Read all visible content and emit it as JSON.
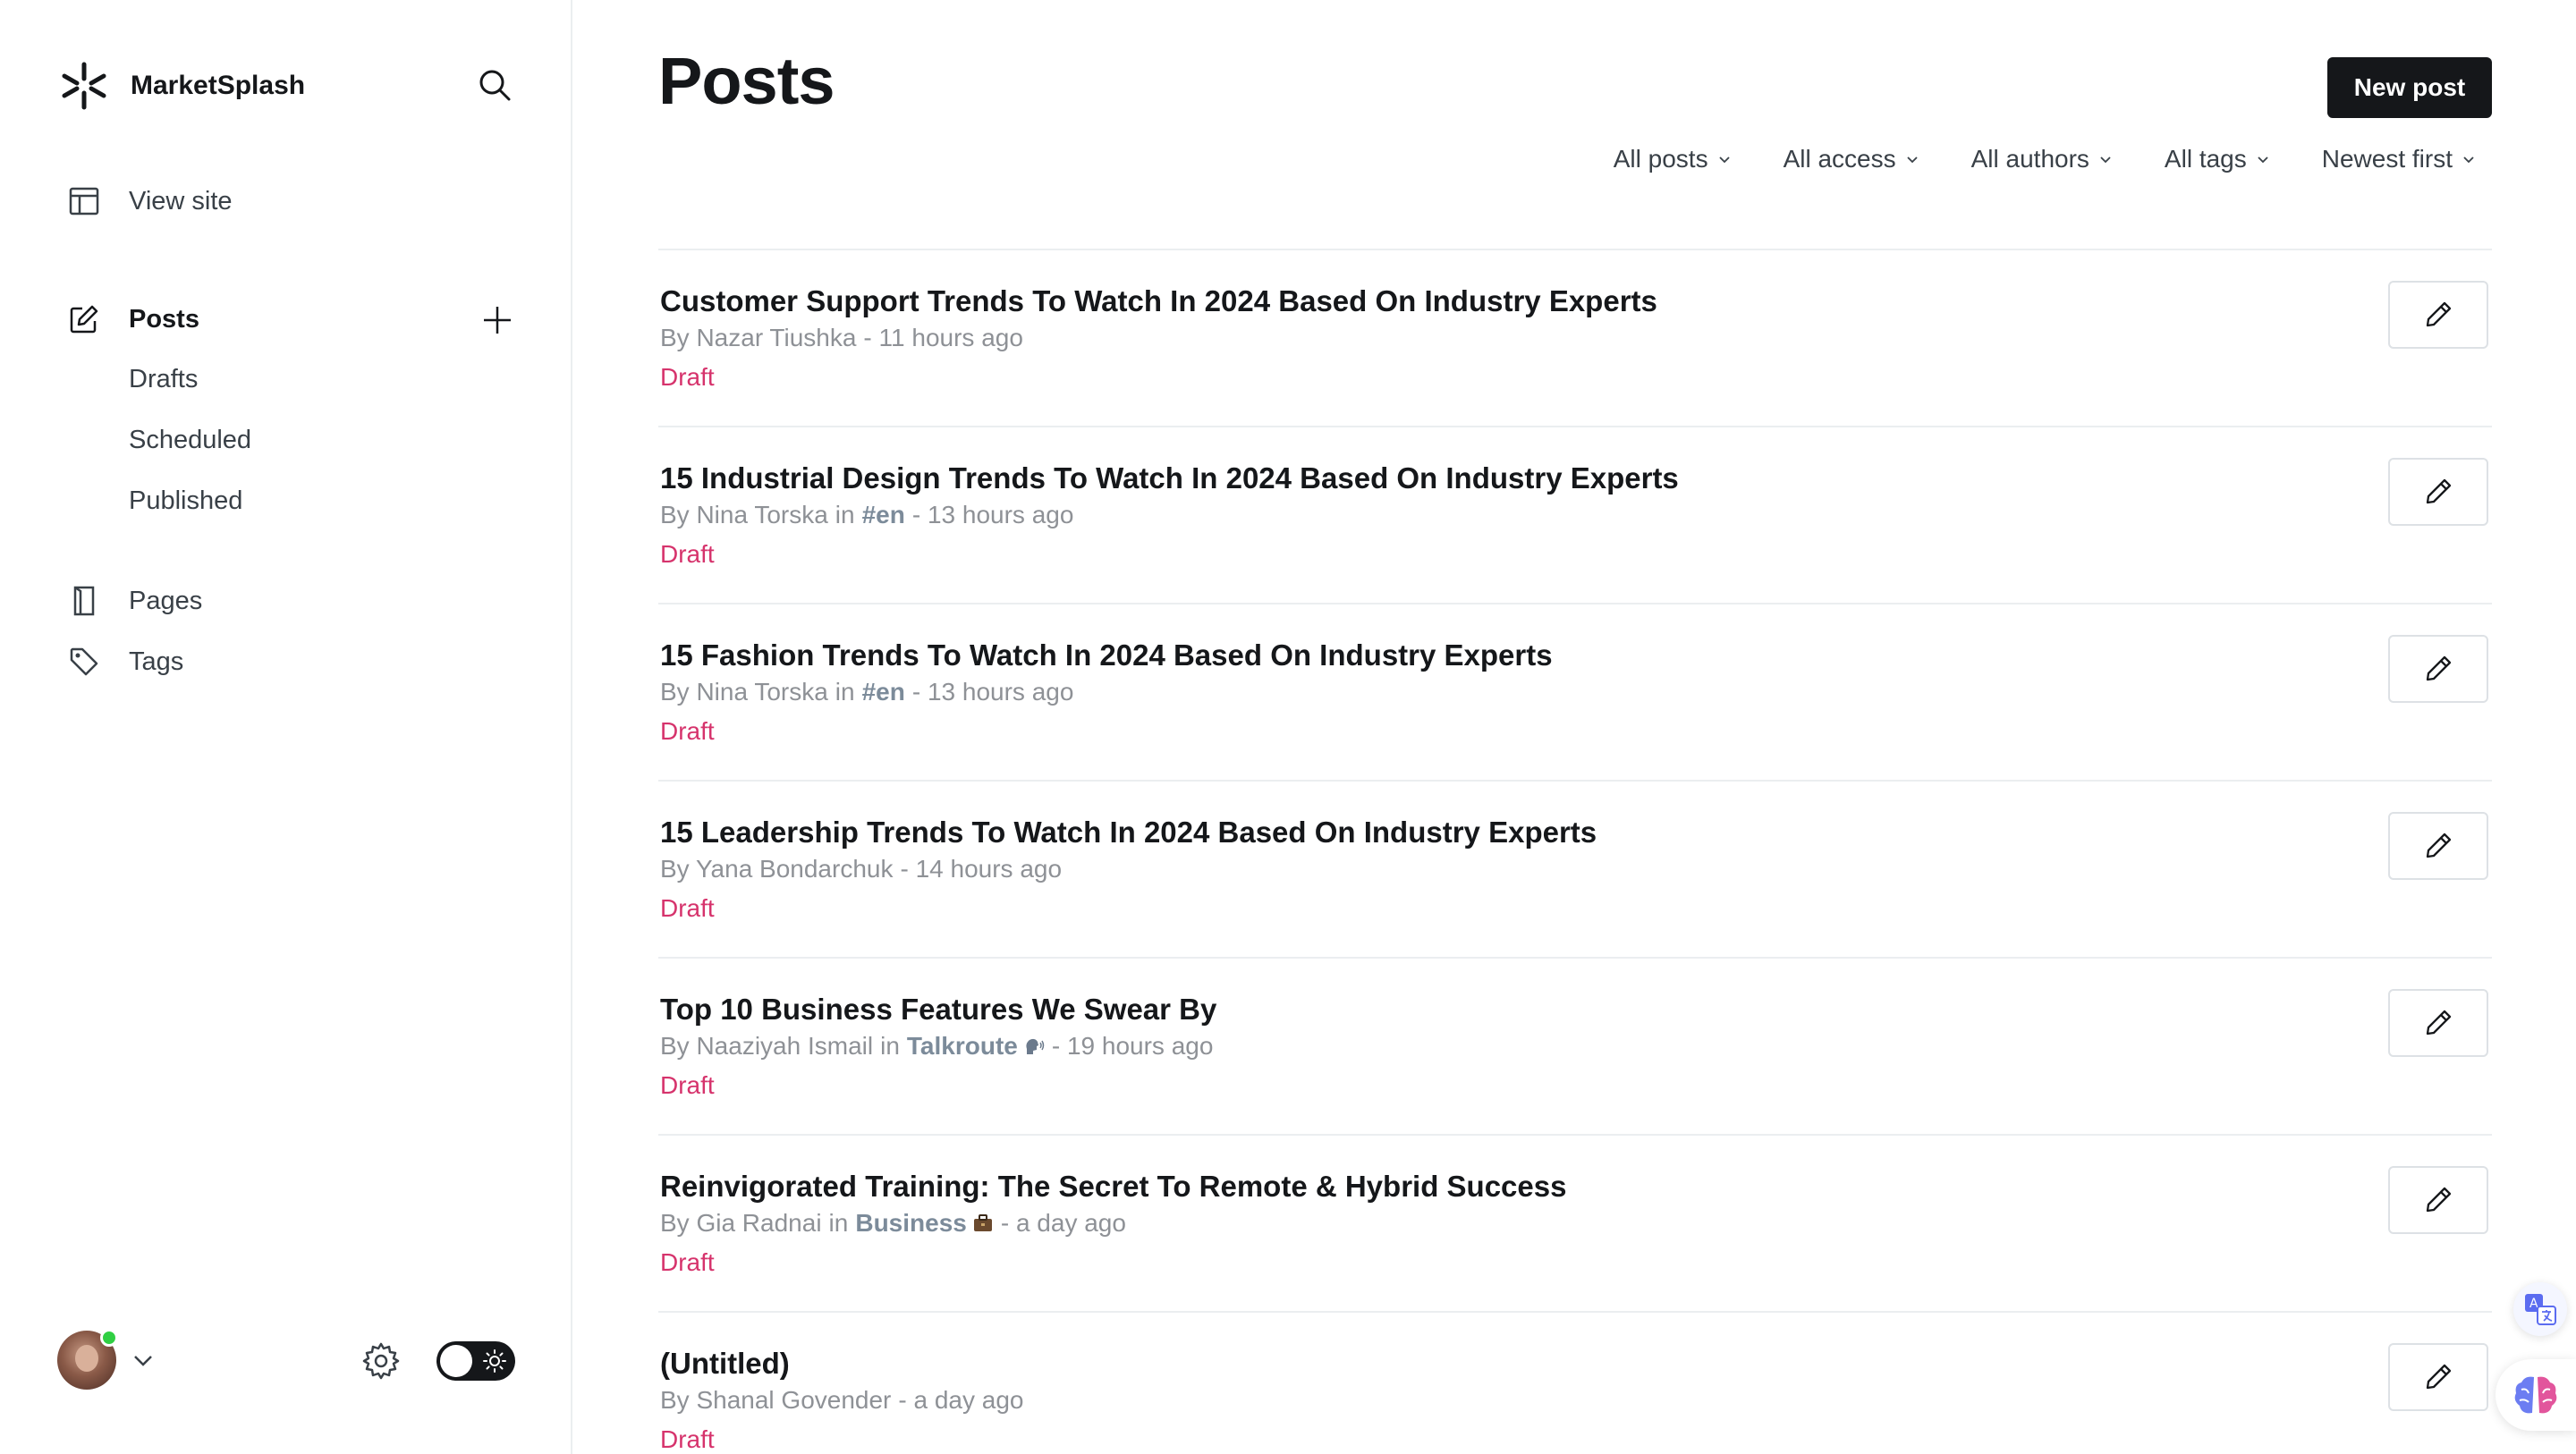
{
  "brand": {
    "name": "MarketSplash"
  },
  "sidebar": {
    "view_site": "View site",
    "posts": "Posts",
    "sub_items": [
      "Drafts",
      "Scheduled",
      "Published"
    ],
    "pages": "Pages",
    "tags": "Tags"
  },
  "header": {
    "title": "Posts",
    "new_post_label": "New post"
  },
  "filters": [
    "All posts",
    "All access",
    "All authors",
    "All tags",
    "Newest first"
  ],
  "posts": [
    {
      "title": "Customer Support Trends To Watch In 2024 Based On Industry Experts",
      "by": "By Nazar Tiushka",
      "in": "",
      "tag": "",
      "time": "- 11 hours ago",
      "status": "Draft"
    },
    {
      "title": "15 Industrial Design Trends To Watch In 2024 Based On Industry Experts",
      "by": "By Nina Torska",
      "in": "in",
      "tag": "#en",
      "time": "- 13 hours ago",
      "status": "Draft"
    },
    {
      "title": "15 Fashion Trends To Watch In 2024 Based On Industry Experts",
      "by": "By Nina Torska",
      "in": "in",
      "tag": "#en",
      "time": "- 13 hours ago",
      "status": "Draft"
    },
    {
      "title": "15 Leadership Trends To Watch In 2024 Based On Industry Experts",
      "by": "By Yana Bondarchuk",
      "in": "",
      "tag": "",
      "time": "- 14 hours ago",
      "status": "Draft"
    },
    {
      "title": "Top 10 Business Features We Swear By",
      "by": "By Naaziyah Ismail",
      "in": "in",
      "tag": "Talkroute",
      "time": "- 19 hours ago",
      "status": "Draft",
      "tag_icon": "speaking-head-emoji"
    },
    {
      "title": "Reinvigorated Training: The Secret To Remote & Hybrid Success",
      "by": "By Gia Radnai",
      "in": "in",
      "tag": "Business",
      "time": "- a day ago",
      "status": "Draft",
      "tag_icon": "briefcase-emoji"
    },
    {
      "title": "(Untitled)",
      "by": "By Shanal Govender",
      "in": "",
      "tag": "",
      "time": "- a day ago",
      "status": "Draft"
    }
  ],
  "colors": {
    "accent_draft": "#d6336c",
    "primary_dark": "#15171a",
    "online": "#30cf43"
  }
}
